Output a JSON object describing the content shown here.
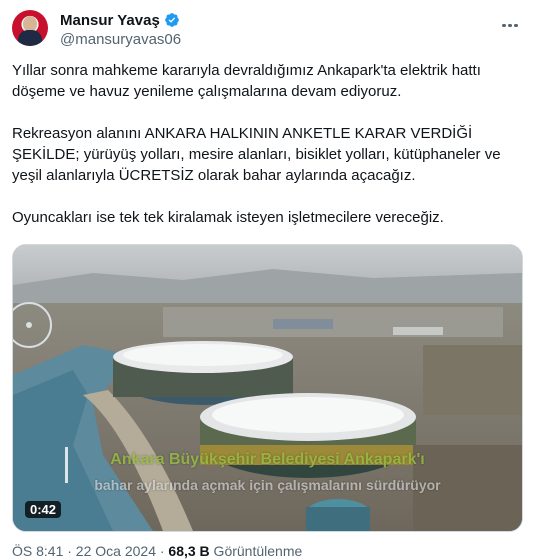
{
  "author": {
    "name": "Mansur Yavaş",
    "handle": "@mansuryavas06",
    "verified_color": "#1d9bf0"
  },
  "tweet": {
    "text": "Yıllar sonra mahkeme kararıyla devraldığımız Ankapark'ta elektrik hattı döşeme ve havuz yenileme çalışmalarına devam ediyoruz.\n\nRekreasyon alanını ANKARA HALKININ ANKETLE KARAR VERDİĞİ ŞEKİLDE; yürüyüş yolları, mesire alanları, bisiklet yolları, kütüphaneler ve yeşil alanlarıyla ÜCRETSİZ olarak bahar aylarında açacağız.\n\nOyuncakları ise tek tek kiralamak isteyen işletmecilere vereceğiz."
  },
  "media": {
    "type": "video",
    "duration": "0:42",
    "caption_line1": "Ankara Büyükşehir Belediyesi Ankapark'ı",
    "caption_line2": "bahar aylarında açmak için çalışmalarını sürdürüyor"
  },
  "meta": {
    "time": "ÖS 8:41 · 22 Oca 2024 · ",
    "views_count": "68,3 B",
    "views_label": " Görüntülenme"
  },
  "icons": {
    "more": "more-icon",
    "verified": "verified-badge-icon"
  }
}
